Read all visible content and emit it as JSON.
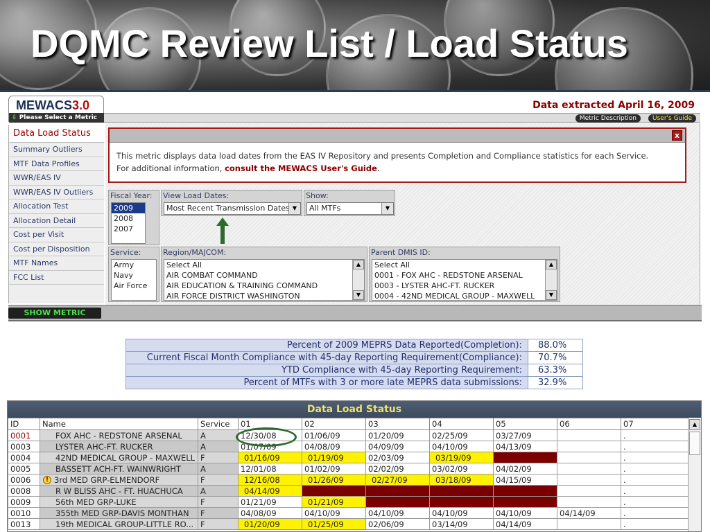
{
  "slide": {
    "title": "DQMC Review List / Load Status"
  },
  "app": {
    "brand_name": "MEWACS",
    "brand_version": "3.0",
    "brand_hint": "Please Select a Metric",
    "extract_note": "Data extracted April 16, 2009",
    "metric_description_label": "Metric Description",
    "users_guide_label": "User's Guide"
  },
  "sidebar": {
    "active": "Data Load Status",
    "items": [
      "Summary Outliers",
      "MTF Data Profiles",
      "WWR/EAS IV",
      "WWR/EAS IV Outliers",
      "Allocation Test",
      "Allocation Detail",
      "Cost per Visit",
      "Cost per Disposition",
      "MTF Names",
      "FCC List"
    ],
    "show_metric_label": "SHOW METRIC"
  },
  "info": {
    "close_label": "x",
    "line1": "This metric displays data load dates from the EAS IV Repository and presents Completion and Compliance statistics for each Service.",
    "line2_prefix": "For additional information, ",
    "line2_link": "consult the MEWACS User's Guide",
    "line2_suffix": "."
  },
  "filters": {
    "fiscal_year": {
      "label": "Fiscal Year:",
      "options": [
        "2009",
        "2008",
        "2007"
      ],
      "selected": "2009"
    },
    "view_load_dates": {
      "label": "View Load Dates:",
      "value": "Most Recent Transmission Dates"
    },
    "show": {
      "label": "Show:",
      "value": "All MTFs"
    },
    "service": {
      "label": "Service:",
      "options": [
        "Army",
        "Navy",
        "Air Force"
      ]
    },
    "region": {
      "label": "Region/MAJCOM:",
      "options": [
        "Select All",
        "AIR COMBAT COMMAND",
        "AIR EDUCATION & TRAINING COMMAND",
        "AIR FORCE DISTRICT WASHINGTON"
      ]
    },
    "parent_dmis": {
      "label": "Parent DMIS ID:",
      "options": [
        "Select All",
        "0001 - FOX AHC - REDSTONE ARSENAL",
        "0003 - LYSTER AHC-FT. RUCKER",
        "0004 - 42ND MEDICAL GROUP - MAXWELL"
      ]
    }
  },
  "stats": [
    {
      "label": "Percent of 2009 MEPRS Data Reported(Completion):",
      "value": "88.0%"
    },
    {
      "label": "Current Fiscal Month Compliance with 45-day Reporting Requirement(Compliance):",
      "value": "70.7%"
    },
    {
      "label": "YTD Compliance with 45-day Reporting Requirement:",
      "value": "63.3%"
    },
    {
      "label": "Percent of MTFs with 3 or more late MEPRS data submissions:",
      "value": "32.9%"
    }
  ],
  "grid": {
    "title": "Data Load Status",
    "columns": [
      "ID",
      "Name",
      "Service",
      "01",
      "02",
      "03",
      "04",
      "05",
      "06",
      "07"
    ],
    "rows": [
      {
        "id": "0001",
        "name": "FOX AHC - REDSTONE ARSENAL",
        "service": "A",
        "warn": false,
        "cells": [
          [
            "12/30/08",
            "ok"
          ],
          [
            "01/06/09",
            "ok"
          ],
          [
            "01/20/09",
            "ok"
          ],
          [
            "02/25/09",
            "ok"
          ],
          [
            "03/27/09",
            "ok"
          ],
          [
            "",
            "empty"
          ],
          [
            ".",
            "empty"
          ]
        ]
      },
      {
        "id": "0003",
        "name": "LYSTER AHC-FT. RUCKER",
        "service": "A",
        "warn": false,
        "cells": [
          [
            "01/07/09",
            "ok"
          ],
          [
            "04/08/09",
            "ok"
          ],
          [
            "04/09/09",
            "ok"
          ],
          [
            "04/10/09",
            "ok"
          ],
          [
            "04/13/09",
            "ok"
          ],
          [
            "",
            "empty"
          ],
          [
            ".",
            "empty"
          ]
        ]
      },
      {
        "id": "0004",
        "name": "42ND MEDICAL GROUP - MAXWELL",
        "service": "F",
        "warn": false,
        "cells": [
          [
            "01/16/09",
            "late"
          ],
          [
            "01/19/09",
            "late"
          ],
          [
            "02/03/09",
            "ok"
          ],
          [
            "03/19/09",
            "late"
          ],
          [
            "",
            "miss"
          ],
          [
            "",
            "empty"
          ],
          [
            ".",
            "empty"
          ]
        ]
      },
      {
        "id": "0005",
        "name": "BASSETT ACH-FT. WAINWRIGHT",
        "service": "A",
        "warn": false,
        "cells": [
          [
            "12/01/08",
            "ok"
          ],
          [
            "01/02/09",
            "ok"
          ],
          [
            "02/02/09",
            "ok"
          ],
          [
            "03/02/09",
            "ok"
          ],
          [
            "04/02/09",
            "ok"
          ],
          [
            "",
            "empty"
          ],
          [
            ".",
            "empty"
          ]
        ]
      },
      {
        "id": "0006",
        "name": "3rd MED GRP-ELMENDORF",
        "service": "F",
        "warn": true,
        "cells": [
          [
            "12/16/08",
            "late"
          ],
          [
            "01/26/09",
            "late"
          ],
          [
            "02/27/09",
            "late"
          ],
          [
            "03/18/09",
            "late"
          ],
          [
            "04/15/09",
            "ok"
          ],
          [
            "",
            "empty"
          ],
          [
            ".",
            "empty"
          ]
        ]
      },
      {
        "id": "0008",
        "name": "R W BLISS AHC - FT. HUACHUCA",
        "service": "A",
        "warn": false,
        "cells": [
          [
            "04/14/09",
            "late"
          ],
          [
            "",
            "miss"
          ],
          [
            "",
            "miss"
          ],
          [
            "",
            "miss"
          ],
          [
            "",
            "miss"
          ],
          [
            "",
            "empty"
          ],
          [
            ".",
            "empty"
          ]
        ]
      },
      {
        "id": "0009",
        "name": "56th MED GRP-LUKE",
        "service": "F",
        "warn": false,
        "cells": [
          [
            "01/21/09",
            "ok"
          ],
          [
            "01/21/09",
            "late"
          ],
          [
            "",
            "miss"
          ],
          [
            "",
            "miss"
          ],
          [
            "",
            "miss"
          ],
          [
            "",
            "empty"
          ],
          [
            ".",
            "empty"
          ]
        ]
      },
      {
        "id": "0010",
        "name": "355th MED GRP-DAVIS MONTHAN",
        "service": "F",
        "warn": false,
        "cells": [
          [
            "04/08/09",
            "ok"
          ],
          [
            "04/10/09",
            "ok"
          ],
          [
            "04/10/09",
            "ok"
          ],
          [
            "04/10/09",
            "ok"
          ],
          [
            "04/10/09",
            "ok"
          ],
          [
            "04/14/09",
            "ok"
          ],
          [
            ".",
            "empty"
          ]
        ]
      },
      {
        "id": "0013",
        "name": "19th MEDICAL GROUP-LITTLE RO...",
        "service": "F",
        "warn": false,
        "cells": [
          [
            "01/20/09",
            "late"
          ],
          [
            "01/25/09",
            "late"
          ],
          [
            "02/06/09",
            "ok"
          ],
          [
            "03/14/09",
            "ok"
          ],
          [
            "04/14/09",
            "ok"
          ],
          [
            "",
            "empty"
          ],
          [
            ".",
            "empty"
          ]
        ]
      }
    ]
  },
  "colors": {
    "brand_red": "#8b0000",
    "late_yellow": "#fff200",
    "missing_maroon": "#7a0000",
    "link_blue": "#1f2f6a"
  },
  "icons": [
    "close-icon",
    "chevron-down-icon",
    "arrow-up-icon",
    "warning-icon",
    "scroll-up-icon",
    "scroll-down-icon"
  ]
}
